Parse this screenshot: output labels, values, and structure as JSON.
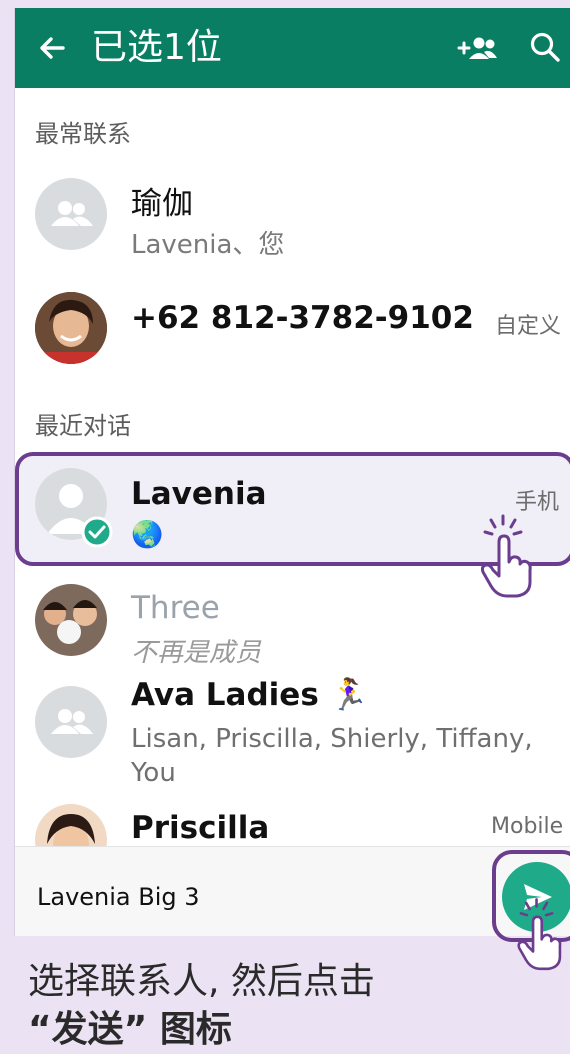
{
  "header": {
    "title": "已选1位",
    "back_icon": "arrow-left-icon",
    "add_group_icon": "add-group-icon",
    "search_icon": "search-icon",
    "color": "#0a7e63"
  },
  "sections": {
    "frequent": "最常联系",
    "recent": "最近对话"
  },
  "frequent": [
    {
      "name": "瑜伽",
      "subtitle": "Lavenia、您",
      "tag": ""
    },
    {
      "name": "+62 812-3782-9102",
      "subtitle": "",
      "tag": "自定义"
    }
  ],
  "recent": [
    {
      "name": "Lavenia",
      "subtitle": "🌏",
      "tag": "手机",
      "selected": true
    },
    {
      "name": "Three",
      "subtitle": "不再是成员",
      "tag": ""
    },
    {
      "name": "Ava Ladies 🏃‍♀️",
      "subtitle": "Lisan, Priscilla, Shierly, Tiffany, You",
      "tag": ""
    },
    {
      "name": "Priscilla",
      "subtitle": "",
      "tag": "Mobile"
    }
  ],
  "bottom": {
    "selected_names": "Lavenia Big 3",
    "send_icon": "send-icon"
  },
  "caption": {
    "line1": "选择联系人, 然后点击",
    "line2": "“发送” 图标"
  },
  "highlight_color": "#6b3d8f",
  "fab_color": "#1fab89"
}
